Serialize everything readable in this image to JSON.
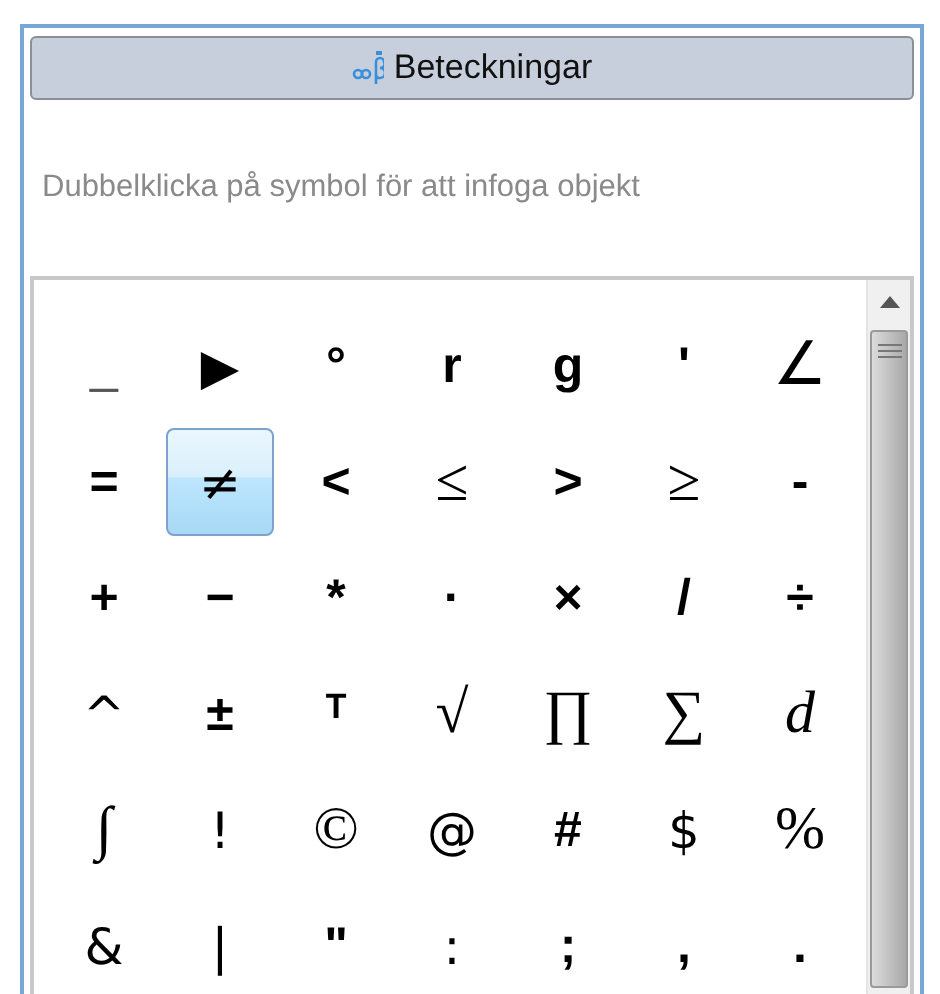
{
  "panel": {
    "title": "Beteckningar",
    "hint": "Dubbelklicka på symbol för att infoga objekt"
  },
  "symbols": [
    {
      "symbol": "_",
      "kind": "light",
      "selected": false
    },
    {
      "symbol": "▶",
      "kind": "plain",
      "selected": false
    },
    {
      "symbol": "°",
      "kind": "bold",
      "selected": false
    },
    {
      "symbol": "r",
      "kind": "bold",
      "selected": false
    },
    {
      "symbol": "g",
      "kind": "bold",
      "selected": false
    },
    {
      "symbol": "'",
      "kind": "bold",
      "selected": false
    },
    {
      "symbol": "∠",
      "kind": "serif",
      "selected": false
    },
    {
      "symbol": "=",
      "kind": "bold",
      "selected": false
    },
    {
      "symbol": "≠",
      "kind": "plain",
      "selected": true
    },
    {
      "symbol": "<",
      "kind": "bold",
      "selected": false
    },
    {
      "symbol": "≤",
      "kind": "serif",
      "selected": false
    },
    {
      "symbol": ">",
      "kind": "bold",
      "selected": false
    },
    {
      "symbol": "≥",
      "kind": "serif",
      "selected": false
    },
    {
      "symbol": "-",
      "kind": "bold",
      "selected": false
    },
    {
      "symbol": "+",
      "kind": "bold",
      "selected": false
    },
    {
      "symbol": "−",
      "kind": "bold",
      "selected": false
    },
    {
      "symbol": "*",
      "kind": "bold",
      "selected": false
    },
    {
      "symbol": "·",
      "kind": "bold",
      "selected": false
    },
    {
      "symbol": "×",
      "kind": "bold",
      "selected": false
    },
    {
      "symbol": "/",
      "kind": "bold",
      "selected": false
    },
    {
      "symbol": "÷",
      "kind": "bold",
      "selected": false
    },
    {
      "symbol": "^",
      "kind": "plain",
      "selected": false
    },
    {
      "symbol": "±",
      "kind": "bold",
      "selected": false
    },
    {
      "symbol": "ᵀ",
      "kind": "bold",
      "selected": false
    },
    {
      "symbol": "√",
      "kind": "serif",
      "selected": false
    },
    {
      "symbol": "∏",
      "kind": "serif",
      "selected": false
    },
    {
      "symbol": "∑",
      "kind": "serif",
      "selected": false
    },
    {
      "symbol": "d",
      "kind": "italic",
      "selected": false
    },
    {
      "symbol": "∫",
      "kind": "serif",
      "selected": false
    },
    {
      "symbol": "!",
      "kind": "plain",
      "selected": false
    },
    {
      "symbol": "©",
      "kind": "serif",
      "selected": false
    },
    {
      "symbol": "@",
      "kind": "plain",
      "selected": false
    },
    {
      "symbol": "#",
      "kind": "bold",
      "selected": false
    },
    {
      "symbol": "$",
      "kind": "plain",
      "selected": false
    },
    {
      "symbol": "%",
      "kind": "serif",
      "selected": false
    },
    {
      "symbol": "&",
      "kind": "plain",
      "selected": false
    },
    {
      "symbol": "|",
      "kind": "plain",
      "selected": false
    },
    {
      "symbol": "\"",
      "kind": "bold",
      "selected": false
    },
    {
      "symbol": ":",
      "kind": "plain",
      "selected": false
    },
    {
      "symbol": ";",
      "kind": "bold",
      "selected": false
    },
    {
      "symbol": ",",
      "kind": "bold",
      "selected": false
    },
    {
      "symbol": ".",
      "kind": "bold",
      "selected": false
    }
  ]
}
